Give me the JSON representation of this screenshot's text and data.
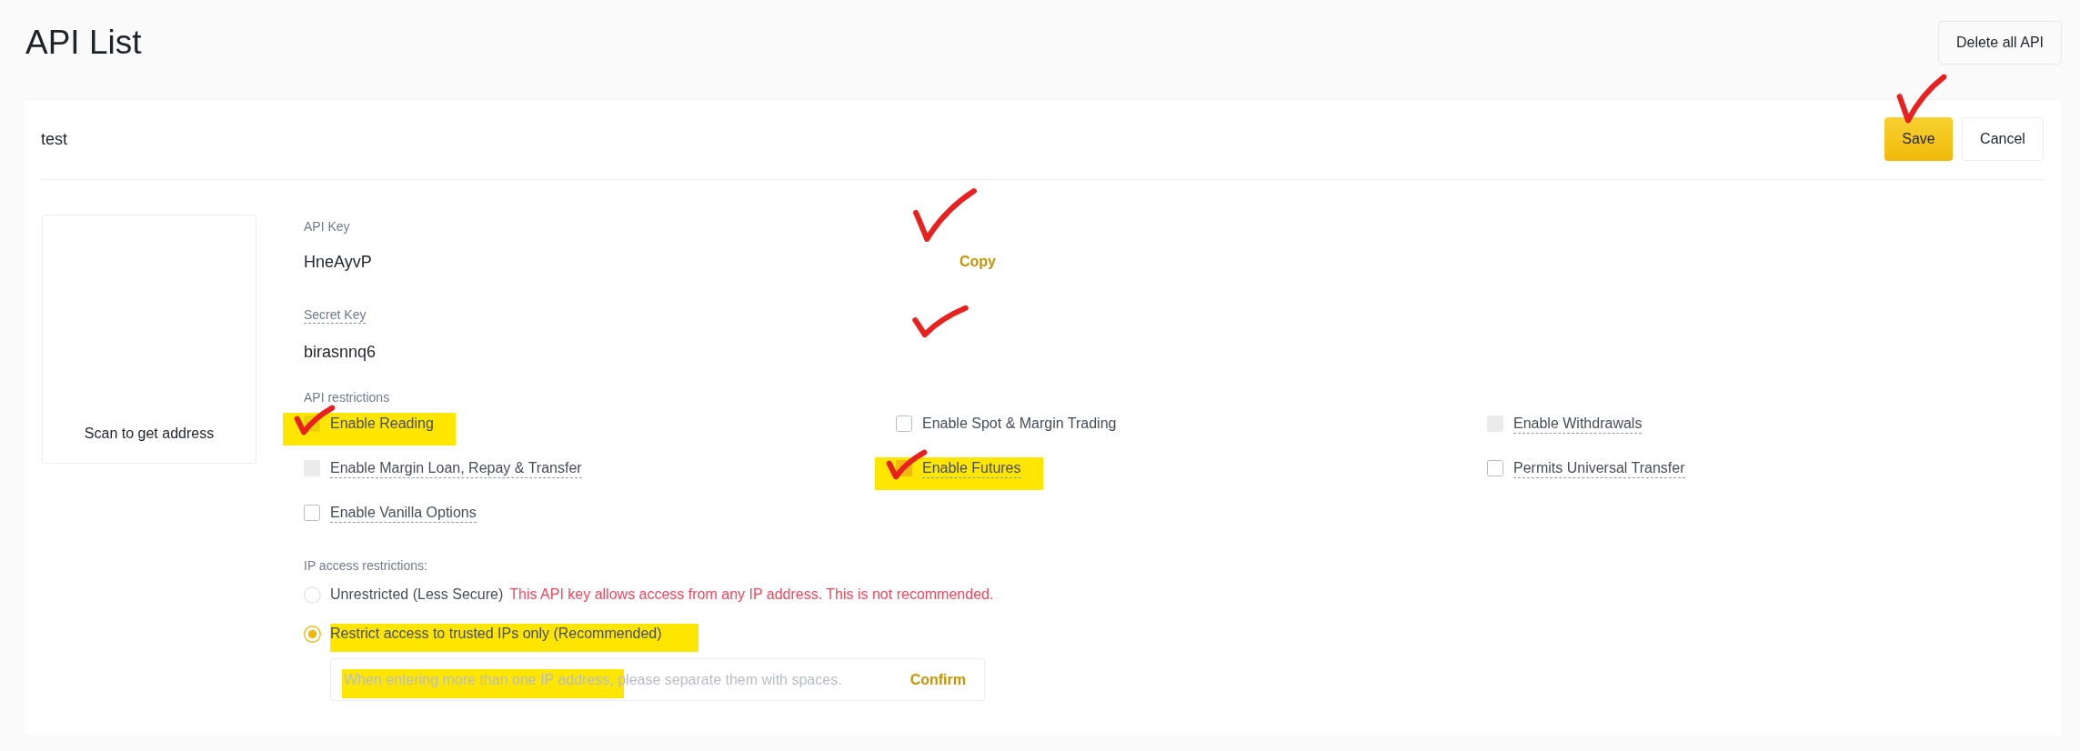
{
  "header": {
    "title": "API List",
    "delete_all_button": "Delete all API"
  },
  "api_card": {
    "name": "test",
    "save_button": {
      "label": "Save",
      "annotation_tick": true
    },
    "cancel_button": "Cancel",
    "qr_panel": {
      "caption": "Scan to get address"
    },
    "api_key": {
      "label": "API Key",
      "value": "HneAyvP",
      "copy_link": "Copy",
      "annotation_tick": true,
      "dashed_underline": false
    },
    "secret_key": {
      "label": "Secret Key",
      "value": "birasnnq6",
      "annotation_tick": true,
      "dashed_underline": true
    },
    "api_restrictions": {
      "label": "API restrictions",
      "options": [
        {
          "label": "Enable Reading",
          "checked": true,
          "disabled": true,
          "dashed_underline": false,
          "highlighted": true,
          "annotation_tick": true
        },
        {
          "label": "Enable Spot & Margin Trading",
          "checked": false,
          "disabled": false,
          "dashed_underline": false,
          "highlighted": false,
          "annotation_tick": false
        },
        {
          "label": "Enable Withdrawals",
          "checked": false,
          "disabled": true,
          "dashed_underline": true,
          "highlighted": false,
          "annotation_tick": false
        },
        {
          "label": "Enable Margin Loan, Repay & Transfer",
          "checked": false,
          "disabled": true,
          "dashed_underline": true,
          "highlighted": false,
          "annotation_tick": false
        },
        {
          "label": "Enable Futures",
          "checked": true,
          "disabled": false,
          "dashed_underline": true,
          "highlighted": true,
          "annotation_tick": true
        },
        {
          "label": "Permits Universal Transfer",
          "checked": false,
          "disabled": false,
          "dashed_underline": true,
          "highlighted": false,
          "annotation_tick": false
        },
        {
          "label": "Enable Vanilla Options",
          "checked": false,
          "disabled": false,
          "dashed_underline": true,
          "highlighted": false,
          "annotation_tick": false
        }
      ]
    },
    "ip_restrictions": {
      "label": "IP access restrictions:",
      "choices": [
        {
          "label": "Unrestricted (Less Secure)",
          "selected": false,
          "highlighted": false,
          "warning": "This API key allows access from any IP address. This is not recommended."
        },
        {
          "label": "Restrict access to trusted IPs only (Recommended)",
          "selected": true,
          "highlighted": true
        }
      ],
      "ip_field": {
        "placeholder": "When entering more than one IP address, please separate them with spaces.",
        "highlighted": true,
        "confirm_button": "Confirm"
      }
    }
  }
}
